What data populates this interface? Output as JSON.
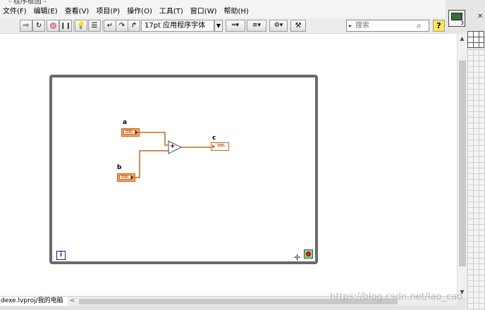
{
  "window": {
    "title_fragment": "- 程序框图 -",
    "vi_icon_number": "3"
  },
  "menubar": {
    "items": [
      "文件(F)",
      "编辑(E)",
      "查看(V)",
      "项目(P)",
      "操作(O)",
      "工具(T)",
      "窗口(W)",
      "帮助(H)"
    ]
  },
  "toolbar": {
    "font_ring_label": "17pt 应用程序字体",
    "search_placeholder": "搜索",
    "help_label": "?"
  },
  "diagram": {
    "control_a_label": "a",
    "control_b_label": "b",
    "indicator_c_label": "c",
    "terminal_type": "DBL",
    "add_symbol": "+",
    "iteration_label": "i"
  },
  "statusbar": {
    "project_path": "dexe.lvproj/我的电脑",
    "scroll_left": "<"
  },
  "watermark": "https://blog.csdn.net/lao_cao",
  "colors": {
    "dbl_wire": "#c8641e",
    "loop_border": "#6a6a6a",
    "iteration_blue": "#1a1a9a",
    "stop_red": "#e02020"
  }
}
